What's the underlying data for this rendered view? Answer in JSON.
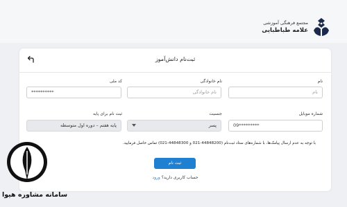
{
  "header": {
    "org_line1": "مجتمع فرهنگی آموزشی",
    "org_line2": "علامه طباطبایی"
  },
  "form": {
    "title": "ثبت‌نام دانش‌آموز",
    "fields": {
      "first_name": {
        "label": "نام",
        "placeholder": "نام",
        "value": ""
      },
      "last_name": {
        "label": "نام خانوادگی",
        "placeholder": "نام خانوادگی",
        "value": ""
      },
      "national_code": {
        "label": "کد ملی",
        "value": "**********"
      },
      "mobile": {
        "label": "شماره موبایل",
        "value": "09*********"
      },
      "gender": {
        "label": "جنسیت",
        "value": "پسر"
      },
      "grade": {
        "label": "ثبت نام برای پایه",
        "value": "پایه هفتم – دوره اول متوسطه"
      }
    },
    "notice": "با توجه به عدم ارسال پیامک‌ها، با شماره‌های ستاد ثبت‌نام (44848200-021 و 44848300-021) تماس حاصل فرمایید.",
    "submit_label": "ثبت نام",
    "login_prompt": "حساب کاربری دارید؟",
    "login_link": "ورود"
  },
  "watermark": {
    "text": "سامانه مشاوره هیوا"
  },
  "icons": {
    "back": "back-arrow-icon",
    "logo": "org-logo",
    "dropdown": "chevron-down-icon"
  },
  "colors": {
    "primary": "#1f7fd0",
    "background": "#eef0f4"
  }
}
